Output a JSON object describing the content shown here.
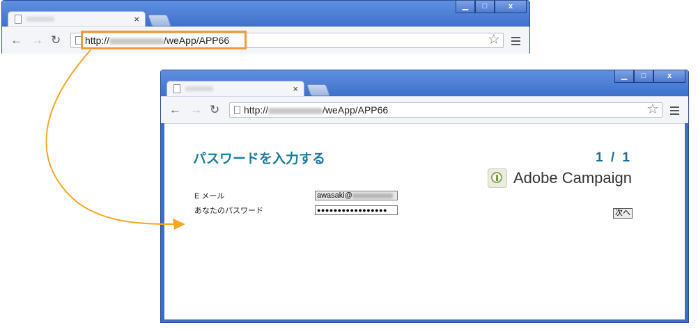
{
  "browser": {
    "url_prefix": "http://",
    "url_suffix": "/weApp/APP66",
    "tab_close": "×",
    "window_controls": {
      "minimize": "▁",
      "maximize": "□",
      "close": "x"
    },
    "icons": [
      "back-arrow-icon",
      "forward-arrow-icon",
      "reload-icon",
      "page-icon",
      "star-icon",
      "menu-icon"
    ]
  },
  "page": {
    "title": "パスワードを入力する",
    "pager": "1 / 1",
    "brand": "Adobe Campaign",
    "form": {
      "email_label": "E メール",
      "email_value_prefix": "awasaki@",
      "password_label": "あなたのパスワード",
      "password_value": "●●●●●●●●●●●●●●●●●"
    },
    "next_button": "次へ"
  },
  "colors": {
    "highlight": "#f29a3a",
    "arrow": "#f5a623",
    "title": "#1a7aa0",
    "window_frame": "#3d6ec4"
  }
}
